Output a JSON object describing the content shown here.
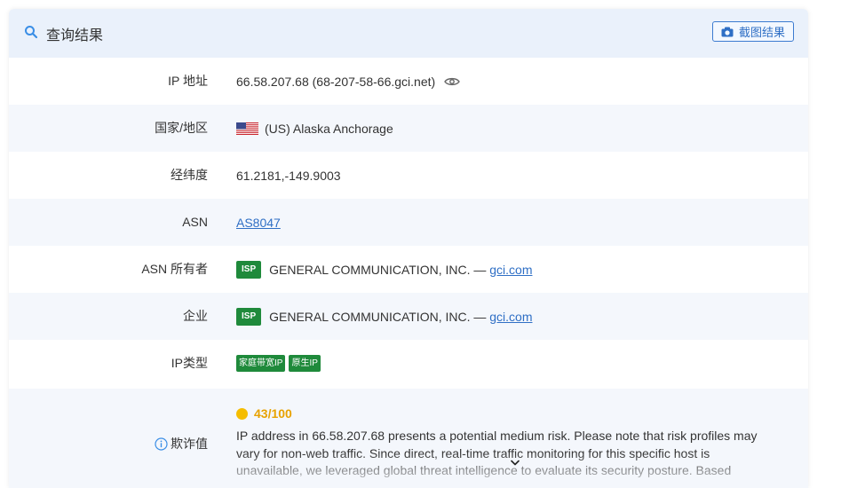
{
  "header": {
    "title": "查询结果",
    "screenshot_button": "截图结果"
  },
  "rows": {
    "ip": {
      "label": "IP 地址",
      "value": "66.58.207.68 (68-207-58-66.gci.net)"
    },
    "region": {
      "label": "国家/地区",
      "value": "(US) Alaska Anchorage"
    },
    "coords": {
      "label": "经纬度",
      "value": "61.2181,-149.9003"
    },
    "asn": {
      "label": "ASN",
      "value": "AS8047"
    },
    "asn_owner": {
      "label": "ASN 所有者",
      "badge": "ISP",
      "name": "GENERAL COMMUNICATION, INC. —",
      "link": "gci.com"
    },
    "company": {
      "label": "企业",
      "badge": "ISP",
      "name": "GENERAL COMMUNICATION, INC. —",
      "link": "gci.com"
    },
    "ip_type": {
      "label": "IP类型",
      "tags": [
        "家庭带宽IP",
        "原生IP"
      ]
    },
    "fraud": {
      "label": "欺诈值",
      "score": "43/100",
      "description": "IP address in 66.58.207.68 presents a potential medium risk. Please note that risk profiles may vary for non-web traffic. Since direct, real-time traffic monitoring for this specific host is unavailable, we leveraged global threat intelligence to evaluate its security posture. Based"
    }
  },
  "colors": {
    "header_bg": "#eaf1fb",
    "alt_row_bg": "#f4f7fc",
    "link": "#2f6fc5",
    "badge_green": "#1f8a3b",
    "score_amber": "#e8a200"
  }
}
